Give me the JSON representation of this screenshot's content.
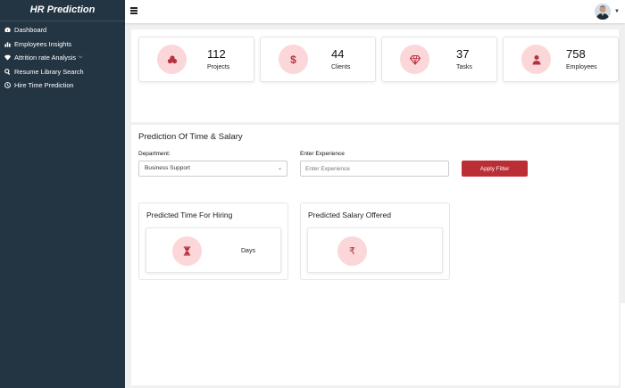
{
  "sidebar": {
    "brand": "HR Prediction",
    "items": [
      {
        "label": "Dashboard",
        "icon": "dashboard-icon"
      },
      {
        "label": "Employees Insights",
        "icon": "chart-icon"
      },
      {
        "label": "Attrition rate Analysis",
        "icon": "diamond-icon",
        "has_dropdown": true
      },
      {
        "label": "Resume Library Search",
        "icon": "search-icon"
      },
      {
        "label": "Hire Time Prediction",
        "icon": "clock-icon"
      }
    ]
  },
  "topbar": {
    "menu_icon": "hamburger-icon",
    "avatar": "user-avatar"
  },
  "stats": [
    {
      "value": "112",
      "label": "Projects",
      "icon": "coins-icon"
    },
    {
      "value": "44",
      "label": "Clients",
      "icon": "dollar-icon"
    },
    {
      "value": "37",
      "label": "Tasks",
      "icon": "diamond-icon"
    },
    {
      "value": "758",
      "label": "Employees",
      "icon": "user-icon"
    }
  ],
  "prediction": {
    "title": "Prediction Of Time & Salary",
    "department_label": "Department:",
    "department_value": "Business Support",
    "experience_label": "Enter Experience",
    "experience_placeholder": "Enter Experience",
    "apply_label": "Apply Filter"
  },
  "results": {
    "time": {
      "title": "Predicted Time For Hiring",
      "unit": "Days",
      "icon": "hourglass-icon"
    },
    "salary": {
      "title": "Predicted Salary Offered",
      "symbol": "₹",
      "icon": "rupee-icon"
    }
  },
  "colors": {
    "sidebar": "#233443",
    "accent": "#bb2e36",
    "icon_bg": "#fbd7d9"
  }
}
